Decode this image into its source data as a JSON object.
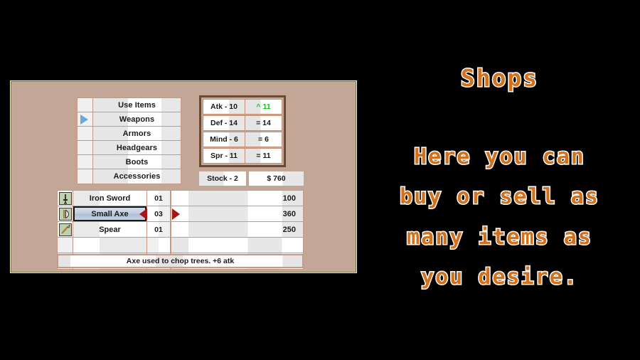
{
  "shop": {
    "categories": [
      {
        "label": "Use Items",
        "selected": false
      },
      {
        "label": "Weapons",
        "selected": true
      },
      {
        "label": "Armors",
        "selected": false
      },
      {
        "label": "Headgears",
        "selected": false
      },
      {
        "label": "Boots",
        "selected": false
      },
      {
        "label": "Accessories",
        "selected": false
      }
    ],
    "stats": [
      {
        "name": "Atk - 10",
        "value": "^ 11",
        "changed": true
      },
      {
        "name": "Def - 14",
        "value": "= 14",
        "changed": false
      },
      {
        "name": "Mind - 6",
        "value": "= 6",
        "changed": false
      },
      {
        "name": "Spr - 11",
        "value": "= 11",
        "changed": false
      }
    ],
    "stock_label": "Stock - 2",
    "money_label": "$ 760",
    "items": [
      {
        "icon": "sword-icon",
        "name": "Iron Sword",
        "qty": "01",
        "price": "100",
        "selected": false
      },
      {
        "icon": "axe-icon",
        "name": "Small Axe",
        "qty": "03",
        "price": "360",
        "selected": true
      },
      {
        "icon": "spear-icon",
        "name": "Spear",
        "qty": "01",
        "price": "250",
        "selected": false
      },
      {
        "icon": "",
        "name": "",
        "qty": "",
        "price": "",
        "selected": false
      },
      {
        "icon": "",
        "name": "",
        "qty": "",
        "price": "",
        "selected": false
      }
    ],
    "description": "Axe used to chop trees. +6 atk"
  },
  "callout": {
    "title": "Shops",
    "lines": [
      "Here you can",
      "buy or sell as",
      "many items as",
      "you desire."
    ]
  },
  "colors": {
    "panel_bg": "#c4a696",
    "frame": "#eeeeaa",
    "accent_orange": "#d2701c",
    "stat_up_green": "#18c21a",
    "arrow_red": "#a81515",
    "cursor_blue": "#67a9d8"
  }
}
